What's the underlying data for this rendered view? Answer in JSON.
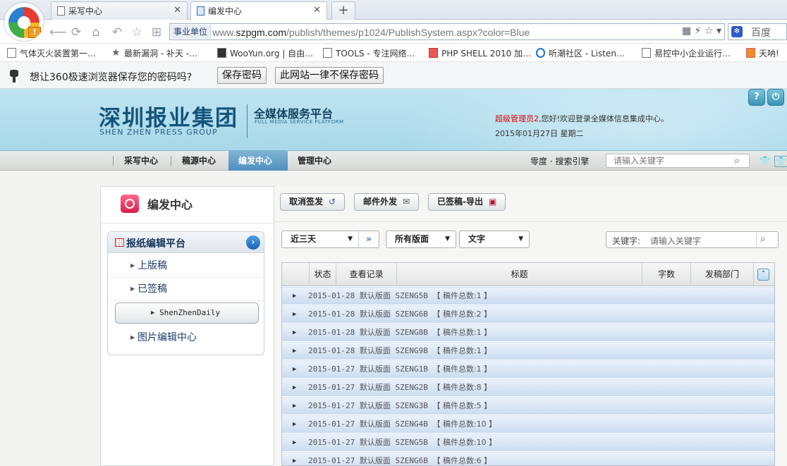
{
  "browser": {
    "tabs": [
      {
        "label": "采写中心",
        "active": false
      },
      {
        "label": "编发中心",
        "active": true
      }
    ],
    "url_zone": "事业单位",
    "url_prefix": "www.",
    "url_host": "szpgm.com",
    "url_path": "/publish/themes/p1024/PublishSystem.aspx?color=Blue",
    "search_engine": "百度",
    "bookmarks": [
      "气体灭火装置第一…",
      "最新漏洞 - 补天 -…",
      "WooYun.org | 自由…",
      "TOOLS - 专注网络…",
      "PHP SHELL 2010 加…",
      "听潮社区 - Listen…",
      "易控中小企业运行…",
      "天呐!"
    ],
    "password_prompt": {
      "message": "想让360极速浏览器保存您的密码吗?",
      "save_label": "保存密码",
      "never_label": "此网站一律不保存密码"
    }
  },
  "header": {
    "brand_cn": "深圳报业集团",
    "brand_en": "SHEN ZHEN PRESS GROUP",
    "platform_cn": "全媒体服务平台",
    "platform_en": "FULL MEDIA SERVICE PLATFORM",
    "admin_name": "超级管理员2",
    "welcome_text": ",您好!欢迎登录全媒体信息集成中心。",
    "date_text": "2015年01月27日  星期二"
  },
  "mainnav": {
    "items": [
      {
        "label": "采写中心",
        "active": false
      },
      {
        "label": "稿源中心",
        "active": false
      },
      {
        "label": "编发中心",
        "active": true
      },
      {
        "label": "管理中心",
        "active": false
      }
    ],
    "engine_label": "零度 · 搜索引擎",
    "search_placeholder": "请输入关键字"
  },
  "left_panel": {
    "title": "编发中心",
    "platform_title": "报纸编辑平台",
    "tree": [
      {
        "label": "上版稿"
      },
      {
        "label": "已签稿"
      },
      {
        "label": "ShenZhenDaily"
      },
      {
        "label": "图片编辑中心"
      }
    ]
  },
  "toolbar": {
    "cancel_label": "取消签发",
    "mail_label": "邮件外发",
    "export_label": "已签稿-导出"
  },
  "filters": {
    "range": "近三天",
    "pages": "所有版面",
    "type": "文字",
    "kw_label": "关键字:",
    "kw_placeholder": "请输入关键字"
  },
  "grid": {
    "columns": [
      "状态",
      "查看记录",
      "标题",
      "字数",
      "发稿部门"
    ],
    "rows": [
      {
        "date": "2015-01-28",
        "section": "默认版面",
        "code": "SZENG5B",
        "count_label": "【 稿件总数:1 】"
      },
      {
        "date": "2015-01-28",
        "section": "默认版面",
        "code": "SZENG6B",
        "count_label": "【 稿件总数:2 】"
      },
      {
        "date": "2015-01-28",
        "section": "默认版面",
        "code": "SZENG8B",
        "count_label": "【 稿件总数:1 】"
      },
      {
        "date": "2015-01-28",
        "section": "默认版面",
        "code": "SZENG9B",
        "count_label": "【 稿件总数:1 】"
      },
      {
        "date": "2015-01-27",
        "section": "默认版面",
        "code": "SZENG1B",
        "count_label": "【 稿件总数:1 】"
      },
      {
        "date": "2015-01-27",
        "section": "默认版面",
        "code": "SZENG2B",
        "count_label": "【 稿件总数:8 】"
      },
      {
        "date": "2015-01-27",
        "section": "默认版面",
        "code": "SZENG3B",
        "count_label": "【 稿件总数:5 】"
      },
      {
        "date": "2015-01-27",
        "section": "默认版面",
        "code": "SZENG4B",
        "count_label": "【 稿件总数:10 】"
      },
      {
        "date": "2015-01-27",
        "section": "默认版面",
        "code": "SZENG5B",
        "count_label": "【 稿件总数:10 】"
      },
      {
        "date": "2015-01-27",
        "section": "默认版面",
        "code": "SZENG6B",
        "count_label": "【 稿件总数:6 】"
      }
    ]
  },
  "colors": {
    "accent": "#4f8fbe",
    "header_bg": "#a8d8ea",
    "admin_red": "#dd0000"
  }
}
